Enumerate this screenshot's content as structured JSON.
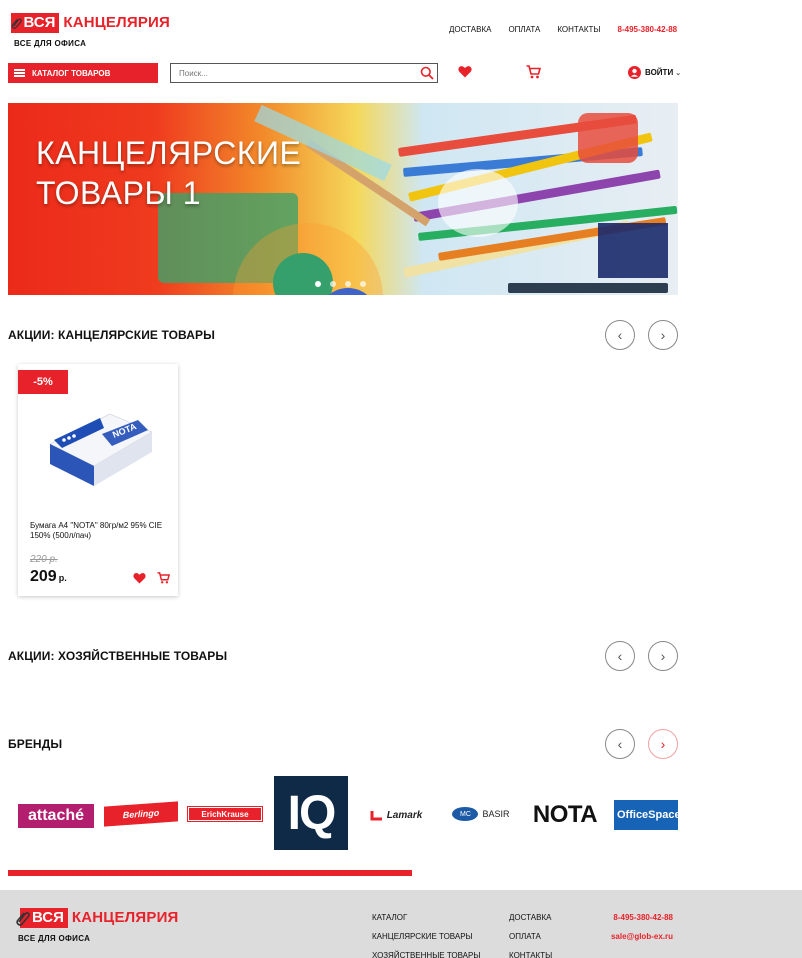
{
  "header": {
    "logo_box": "ВСЯ",
    "logo_text": "КАНЦЕЛЯРИЯ",
    "logo_sub": "ВСЕ ДЛЯ ОФИСА",
    "nav": [
      "ДОСТАВКА",
      "ОПЛАТА",
      "КОНТАКТЫ"
    ],
    "phone": "8-495-380-42-88",
    "catalog_label": "КАТАЛОГ ТОВАРОВ",
    "search_placeholder": "Поиск...",
    "login_label": "ВОЙТИ"
  },
  "banner": {
    "title_line1": "КАНЦЕЛЯРСКИЕ",
    "title_line2": "ТОВАРЫ 1",
    "slides": 4,
    "active_slide": 1
  },
  "sections": {
    "stationery_title": "АКЦИИ: КАНЦЕЛЯРСКИЕ ТОВАРЫ",
    "household_title": "АКЦИИ: ХОЗЯЙСТВЕННЫЕ ТОВАРЫ",
    "brands_title": "БРЕНДЫ"
  },
  "product": {
    "discount": "-5%",
    "name": "Бумага А4 \"NOTA\" 80гр/м2 95% CIE 150% (500л/пач)",
    "old_price": "220 р.",
    "new_price": "209",
    "currency": "р."
  },
  "brands": {
    "attache": "attaché",
    "berlingo": "Berlingo",
    "erichkrause": "ErichKrause",
    "iq": "IQ",
    "lamark": "Lamark",
    "basir_mc": "MC",
    "basir": "BASIR",
    "nota": "NOTA",
    "officespace": "OfficeSpace"
  },
  "footer": {
    "logo_box": "ВСЯ",
    "logo_text": "КАНЦЕЛЯРИЯ",
    "logo_sub": "ВСЕ ДЛЯ ОФИСА",
    "col1": [
      "КАТАЛОГ",
      "КАНЦЕЛЯРСКИЕ ТОВАРЫ",
      "ХОЗЯЙСТВЕННЫЕ ТОВАРЫ"
    ],
    "col2": [
      "ДОСТАВКА",
      "ОПЛАТА",
      "КОНТАКТЫ"
    ],
    "phone": "8-495-380-42-88",
    "email": "sale@glob-ex.ru"
  },
  "colors": {
    "accent": "#e8222a",
    "footer_bg": "#dcdcdc"
  }
}
